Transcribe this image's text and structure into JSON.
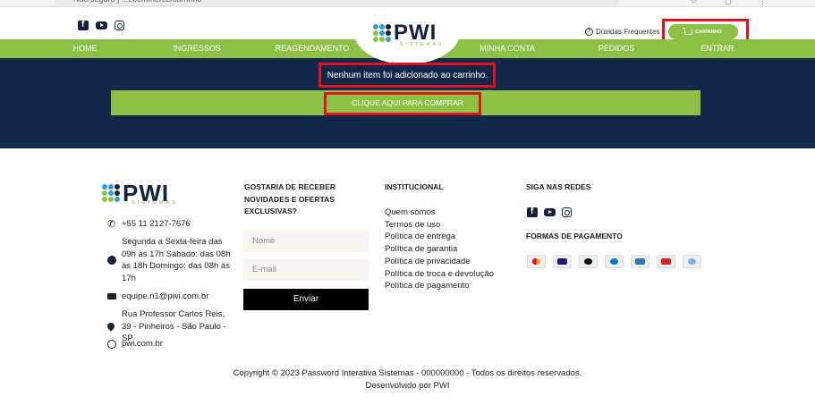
{
  "browser": {
    "url_text": "Não seguro  |  ...ecommerce/carrinho"
  },
  "header": {
    "social": [
      "facebook-icon",
      "youtube-icon",
      "instagram-icon"
    ],
    "logo": {
      "word": "PWI",
      "sub": "SISTEMAS"
    },
    "faq_label": "Dúvidas Frequentes",
    "cart_label": "CARRINHO"
  },
  "nav": {
    "items": [
      {
        "label": "HOME"
      },
      {
        "label": "INGRESSOS"
      },
      {
        "label": "REAGENDAMENTO"
      },
      {
        "label": "MINHA CONTA"
      },
      {
        "label": "PEDIDOS"
      },
      {
        "label": "ENTRAR"
      }
    ]
  },
  "hero": {
    "empty_message": "Nenhum item foi adicionado ao carrinho.",
    "buy_button": "CLIQUE AQUI PARA COMPRAR"
  },
  "footer": {
    "logo": {
      "word": "PWI",
      "sub": "SISTEMAS"
    },
    "contact": {
      "phone": "+55 11 2127-7676",
      "hours": "Segunda a Sexta-feira das 09h às 17h Sábado: das 08h às 18h Domingo: das 08h às 17h",
      "email": "equipe.n1@pwi.com.br",
      "address": "Rua Professor Carlos Reis, 39 - Pinheiros - São Paulo - SP",
      "website": "pwi.com.br"
    },
    "newsletter": {
      "title": "GOSTARIA DE RECEBER NOVIDADES E OFERTAS EXCLUSIVAS?",
      "name_placeholder": "Nome",
      "email_placeholder": "E-mail",
      "submit": "Enviar"
    },
    "institutional": {
      "title": "INSTITUCIONAL",
      "links": [
        "Quem somos",
        "Termos de uso",
        "Política de entrega",
        "Política de garantia",
        "Política de privacidade",
        "Política de troca e devolução",
        "Política de pagamento"
      ]
    },
    "social_title": "SIGA NAS REDES",
    "payment_title": "FORMAS DE PAGAMENTO",
    "payment_icons": [
      "mastercard-icon",
      "visa-icon",
      "elo-icon",
      "diners-icon",
      "amex-icon",
      "hipercard-icon",
      "boleto-icon"
    ],
    "copyright": "Copyright © 2023 Password Interativa Sistemas - 000000000 - Todos os direitos reservados.",
    "developed_by": "Desenvolvido por PWI"
  },
  "colors": {
    "green": "#8dc044",
    "navy": "#12284a",
    "highlight_red": "#e2111d"
  }
}
